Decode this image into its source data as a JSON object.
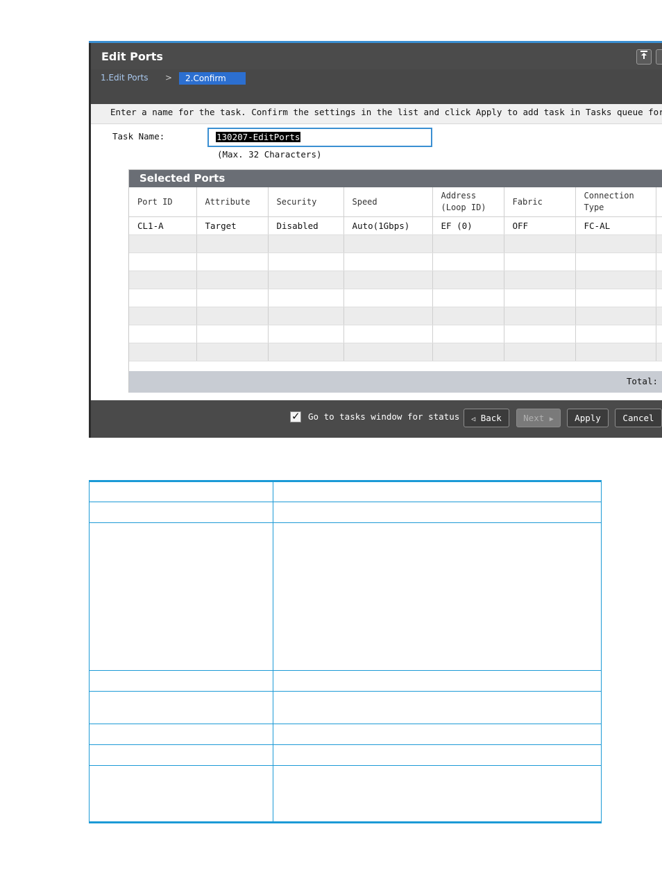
{
  "dialog": {
    "title": "Edit Ports",
    "title_buttons": [
      "pin-icon",
      "restore-icon"
    ],
    "wizard": {
      "step1": "1.Edit Ports",
      "separator": ">",
      "step2": "2.Confirm"
    },
    "instruction": "Enter a name for the task. Confirm the settings in the list and click Apply to add task in Tasks queue for execu",
    "task_name_label": "Task Name:",
    "task_name_value": "130207-EditPorts",
    "task_name_hint": "(Max. 32 Characters)",
    "panel_title": "Selected Ports",
    "columns": [
      "Port ID",
      "Attribute",
      "Security",
      "Speed",
      "Address (Loop ID)",
      "Fabric",
      "Connection Type"
    ],
    "rows": [
      [
        "CL1-A",
        "Target",
        "Disabled",
        "Auto(1Gbps)",
        "EF (0)",
        "OFF",
        "FC-AL"
      ]
    ],
    "total_label": "Total:",
    "footer": {
      "checkbox_checked": true,
      "checkbox_label": "Go to tasks window for status",
      "back": "Back",
      "next": "Next",
      "apply": "Apply",
      "cancel": "Cancel"
    }
  },
  "colors": {
    "accent": "#3a8fd2",
    "table_rule": "#1c9ad6",
    "wizard_active": "#2c6fd0"
  }
}
